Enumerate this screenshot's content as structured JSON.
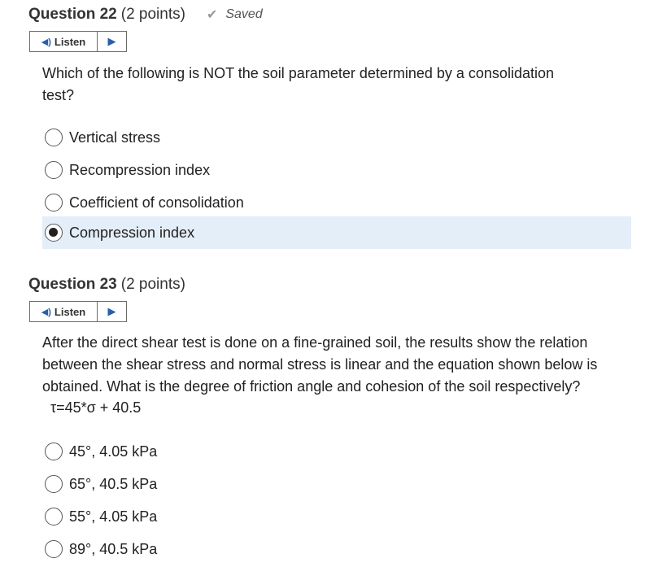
{
  "question22": {
    "title": "Question 22",
    "points": "(2 points)",
    "status": "Saved",
    "listen_label": "Listen",
    "prompt_line1": "Which of the following is NOT the soil parameter determined by a consolidation",
    "prompt_line2": "test?",
    "options": [
      "Vertical stress",
      "Recompression index",
      "Coefficient of consolidation",
      "Compression index"
    ],
    "selected": "Compression index"
  },
  "question23": {
    "title": "Question 23",
    "points": "(2 points)",
    "listen_label": "Listen",
    "prompt_line1": "After the direct shear test is done on a fine-grained soil, the results show the relation",
    "prompt_line2": "between the shear stress and normal stress is linear and the equation shown below is",
    "prompt_line3": "obtained. What is the degree of friction angle and cohesion of the soil respectively?",
    "equation": "τ=45*σ + 40.5",
    "options": [
      "45°, 4.05 kPa",
      "65°, 40.5 kPa",
      "55°, 4.05 kPa",
      "89°, 40.5 kPa"
    ]
  },
  "icons": {
    "speaker": "speaker-icon",
    "play": "play-icon",
    "check": "check-icon"
  },
  "colors": {
    "selected_bg": "#e4eef9",
    "accent": "#2a5ea8"
  }
}
